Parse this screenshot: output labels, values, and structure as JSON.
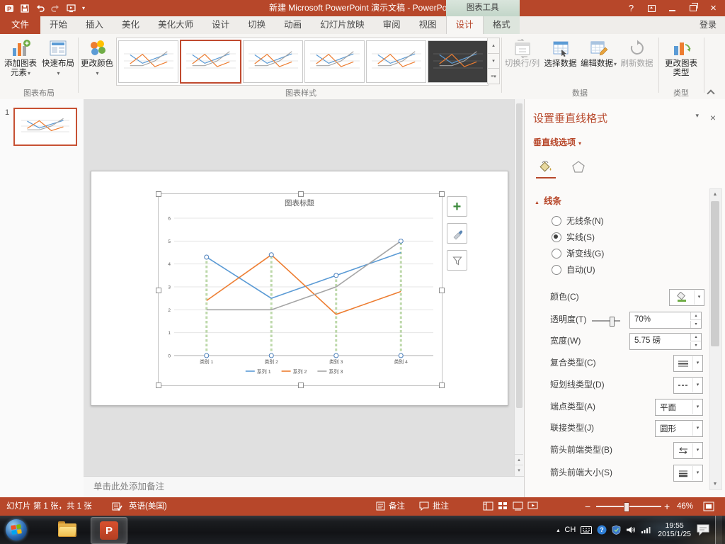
{
  "accent_color": "#B7472A",
  "titlebar": {
    "title": "新建 Microsoft PowerPoint 演示文稿 - PowerPoint",
    "contextual_label": "图表工具",
    "help_label": "?"
  },
  "ribbon": {
    "file_tab": "文件",
    "tabs": [
      "开始",
      "插入",
      "美化",
      "美化大师",
      "设计",
      "切换",
      "动画",
      "幻灯片放映",
      "审阅",
      "视图"
    ],
    "contextual_tabs": [
      {
        "label": "设计",
        "selected": true
      },
      {
        "label": "格式",
        "selected": false
      }
    ],
    "signin_label": "登录",
    "groups": {
      "layout": {
        "label": "图表布局",
        "add_element": "添加图表元素",
        "quick_layout": "快速布局"
      },
      "styles": {
        "label": "图表样式",
        "change_colors": "更改颜色",
        "gallery": {
          "item_count": 6,
          "selected_index": 1,
          "dark_index": 5
        }
      },
      "data": {
        "label": "数据",
        "switch_rowcol": "切换行/列",
        "select_data": "选择数据",
        "edit_data": "编辑数据",
        "refresh_data": "刷新数据"
      },
      "type": {
        "label": "类型",
        "change_type": "更改图表类型"
      }
    }
  },
  "slides_panel": {
    "slide_number": "1"
  },
  "notes": {
    "placeholder": "单击此处添加备注"
  },
  "statusbar": {
    "slide_info": "幻灯片 第 1 张，共 1 张",
    "language": "英语(美国)",
    "notes_label": "备注",
    "comments_label": "批注",
    "zoom": "46%"
  },
  "taskbar": {
    "ime": "CH",
    "time": "19:55",
    "date": "2015/1/25"
  },
  "pane": {
    "title": "设置垂直线格式",
    "options_label": "垂直线选项",
    "section_line": "线条",
    "radios": [
      {
        "label": "无线条(N)",
        "selected": false
      },
      {
        "label": "实线(S)",
        "selected": true
      },
      {
        "label": "渐变线(G)",
        "selected": false
      },
      {
        "label": "自动(U)",
        "selected": false
      }
    ],
    "rows": {
      "color_label": "颜色(C)",
      "transparency_label": "透明度(T)",
      "transparency_value": "70%",
      "width_label": "宽度(W)",
      "width_value": "5.75 磅",
      "compound_label": "复合类型(C)",
      "dash_label": "短划线类型(D)",
      "cap_label": "端点类型(A)",
      "cap_value": "平面",
      "join_label": "联接类型(J)",
      "join_value": "圆形",
      "arrow_begin_type_label": "箭头前端类型(B)",
      "arrow_begin_size_label": "箭头前端大小(S)"
    }
  },
  "chart_data": {
    "type": "line",
    "title": "图表标题",
    "categories": [
      "类别 1",
      "类别 2",
      "类别 3",
      "类别 4"
    ],
    "series": [
      {
        "name": "系列 1",
        "color": "#5B9BD5",
        "values": [
          4.3,
          2.5,
          3.5,
          4.5
        ]
      },
      {
        "name": "系列 2",
        "color": "#ED7D31",
        "values": [
          2.4,
          4.4,
          1.8,
          2.8
        ]
      },
      {
        "name": "系列 3",
        "color": "#A5A5A5",
        "values": [
          2.0,
          2.0,
          3.0,
          5.0
        ]
      }
    ],
    "ylim": [
      0,
      6
    ],
    "ytick_interval": 1,
    "grid": true,
    "legend_position": "bottom",
    "vertical_lines": {
      "visible": true,
      "color": "#70AD47",
      "dash": "dashed",
      "transparency": "70%",
      "width_pt": "5.75"
    }
  }
}
